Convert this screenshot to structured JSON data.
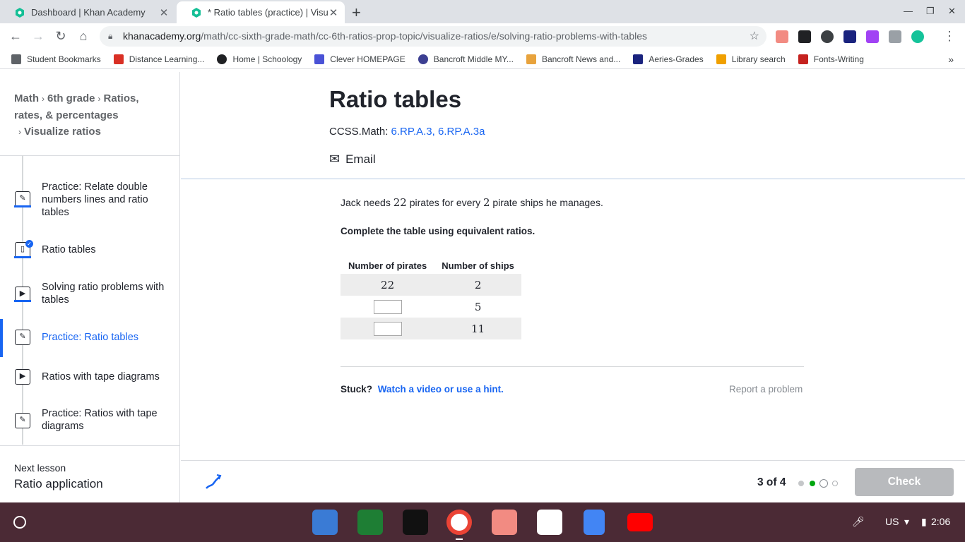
{
  "browser": {
    "tabs": [
      {
        "title": "Dashboard | Khan Academy",
        "active": false
      },
      {
        "title": "* Ratio tables (practice) | Visuali",
        "active": true
      }
    ],
    "url_host": "khanacademy.org",
    "url_path": "/math/cc-sixth-grade-math/cc-6th-ratios-prop-topic/visualize-ratios/e/solving-ratio-problems-with-tables",
    "bookmarks": [
      {
        "label": "Student Bookmarks",
        "color": "#5f6368"
      },
      {
        "label": "Distance Learning...",
        "color": "#d93025"
      },
      {
        "label": "Home | Schoology",
        "color": "#202124"
      },
      {
        "label": "Clever HOMEPAGE",
        "color": "#4a52d6"
      },
      {
        "label": "Bancroft Middle MY...",
        "color": "#3c3f92"
      },
      {
        "label": "Bancroft News and...",
        "color": "#e8a33d"
      },
      {
        "label": "Aeries-Grades",
        "color": "#1a237e"
      },
      {
        "label": "Library search",
        "color": "#f0a000"
      },
      {
        "label": "Fonts-Writing",
        "color": "#c5221f"
      }
    ]
  },
  "breadcrumbs": {
    "items": [
      "Math",
      "6th grade",
      "Ratios, rates, & percentages",
      "Visualize ratios"
    ]
  },
  "sidebar": {
    "lessons": [
      {
        "label": "Practice: Relate double numbers lines and ratio tables",
        "icon": "pencil-icon"
      },
      {
        "label": "Ratio tables",
        "icon": "article-icon"
      },
      {
        "label": "Solving ratio problems with tables",
        "icon": "play-icon"
      },
      {
        "label": "Practice: Ratio tables",
        "icon": "pencil-icon"
      },
      {
        "label": "Ratios with tape diagrams",
        "icon": "play-icon"
      },
      {
        "label": "Practice: Ratios with tape diagrams",
        "icon": "pencil-icon"
      }
    ],
    "next_lesson_label": "Next lesson",
    "next_lesson_title": "Ratio application"
  },
  "header": {
    "title": "Ratio tables",
    "ccss_prefix": "CCSS.Math:",
    "ccss_link1": "6.RP.A.3",
    "ccss_sep": ",",
    "ccss_link2": "6.RP.A.3a",
    "email": "Email"
  },
  "exercise": {
    "q_part1": "Jack needs",
    "q_num1": "22",
    "q_part2": "pirates for every",
    "q_num2": "2",
    "q_part3": "pirate ships he manages.",
    "instruction": "Complete the table using equivalent ratios.",
    "table": {
      "headers": [
        "Number of pirates",
        "Number of ships"
      ],
      "rows": [
        {
          "pirates": "22",
          "ships": "2"
        },
        {
          "pirates": "",
          "ships": "5"
        },
        {
          "pirates": "",
          "ships": "11"
        }
      ]
    },
    "stuck": "Stuck?",
    "hint": "Watch a video or use a hint.",
    "report": "Report a problem"
  },
  "footer": {
    "progress": "3 of 4",
    "check": "Check",
    "accent": "#1865f2"
  },
  "tray": {
    "locale": "US",
    "time": "2:06"
  }
}
